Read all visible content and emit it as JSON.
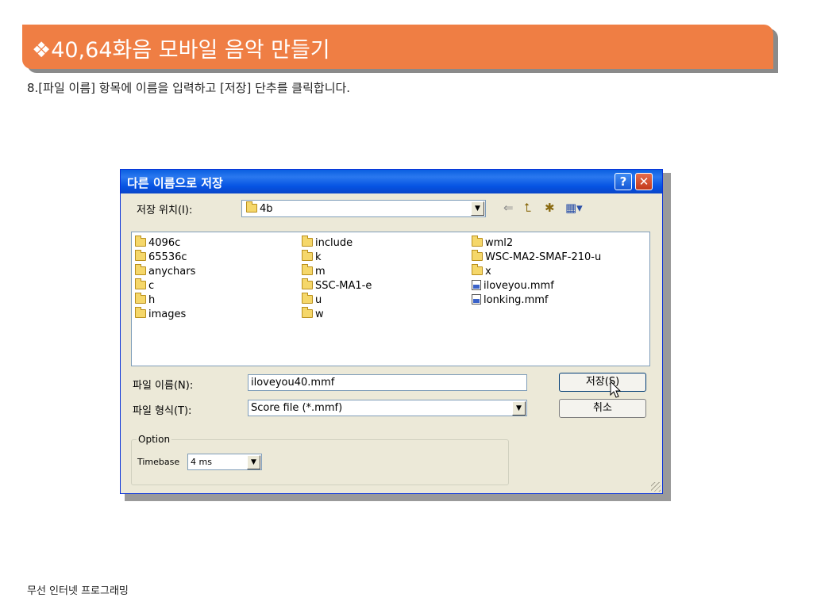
{
  "banner": {
    "title": "❖40,64화음 모바일 음악 만들기"
  },
  "instruction": "8.[파일 이름] 항목에 이름을 입력하고 [저장] 단추를 클릭합니다.",
  "footer": "무선 인터넷 프로그래밍",
  "dialog": {
    "title": "다른 이름으로 저장",
    "help_label": "?",
    "close_label": "✕",
    "save_in_label": "저장 위치(I):",
    "save_in_value": "4b",
    "list": {
      "col1": [
        {
          "name": "4096c",
          "icon": "folder-icon"
        },
        {
          "name": "65536c",
          "icon": "folder-icon"
        },
        {
          "name": "anychars",
          "icon": "folder-icon"
        },
        {
          "name": "c",
          "icon": "folder-icon"
        },
        {
          "name": "h",
          "icon": "folder-icon"
        },
        {
          "name": "images",
          "icon": "folder-icon"
        }
      ],
      "col2": [
        {
          "name": "include",
          "icon": "folder-icon"
        },
        {
          "name": "k",
          "icon": "folder-icon"
        },
        {
          "name": "m",
          "icon": "folder-icon"
        },
        {
          "name": "SSC-MA1-e",
          "icon": "folder-icon"
        },
        {
          "name": "u",
          "icon": "folder-icon"
        },
        {
          "name": "w",
          "icon": "folder-icon"
        }
      ],
      "col3": [
        {
          "name": "wml2",
          "icon": "folder-icon"
        },
        {
          "name": "WSC-MA2-SMAF-210-u",
          "icon": "folder-icon"
        },
        {
          "name": "x",
          "icon": "folder-icon"
        },
        {
          "name": "iloveyou.mmf",
          "icon": "mmf-file-icon"
        },
        {
          "name": "lonking.mmf",
          "icon": "mmf-file-icon"
        }
      ]
    },
    "filename_label": "파일 이름(N):",
    "filename_value": "iloveyou40.mmf",
    "filetype_label": "파일 형식(T):",
    "filetype_value": "Score file (*.mmf)",
    "save_button": "저장(S)",
    "cancel_button": "취소",
    "option_label": "Option",
    "timebase_label": "Timebase",
    "timebase_value": "4 ms"
  }
}
